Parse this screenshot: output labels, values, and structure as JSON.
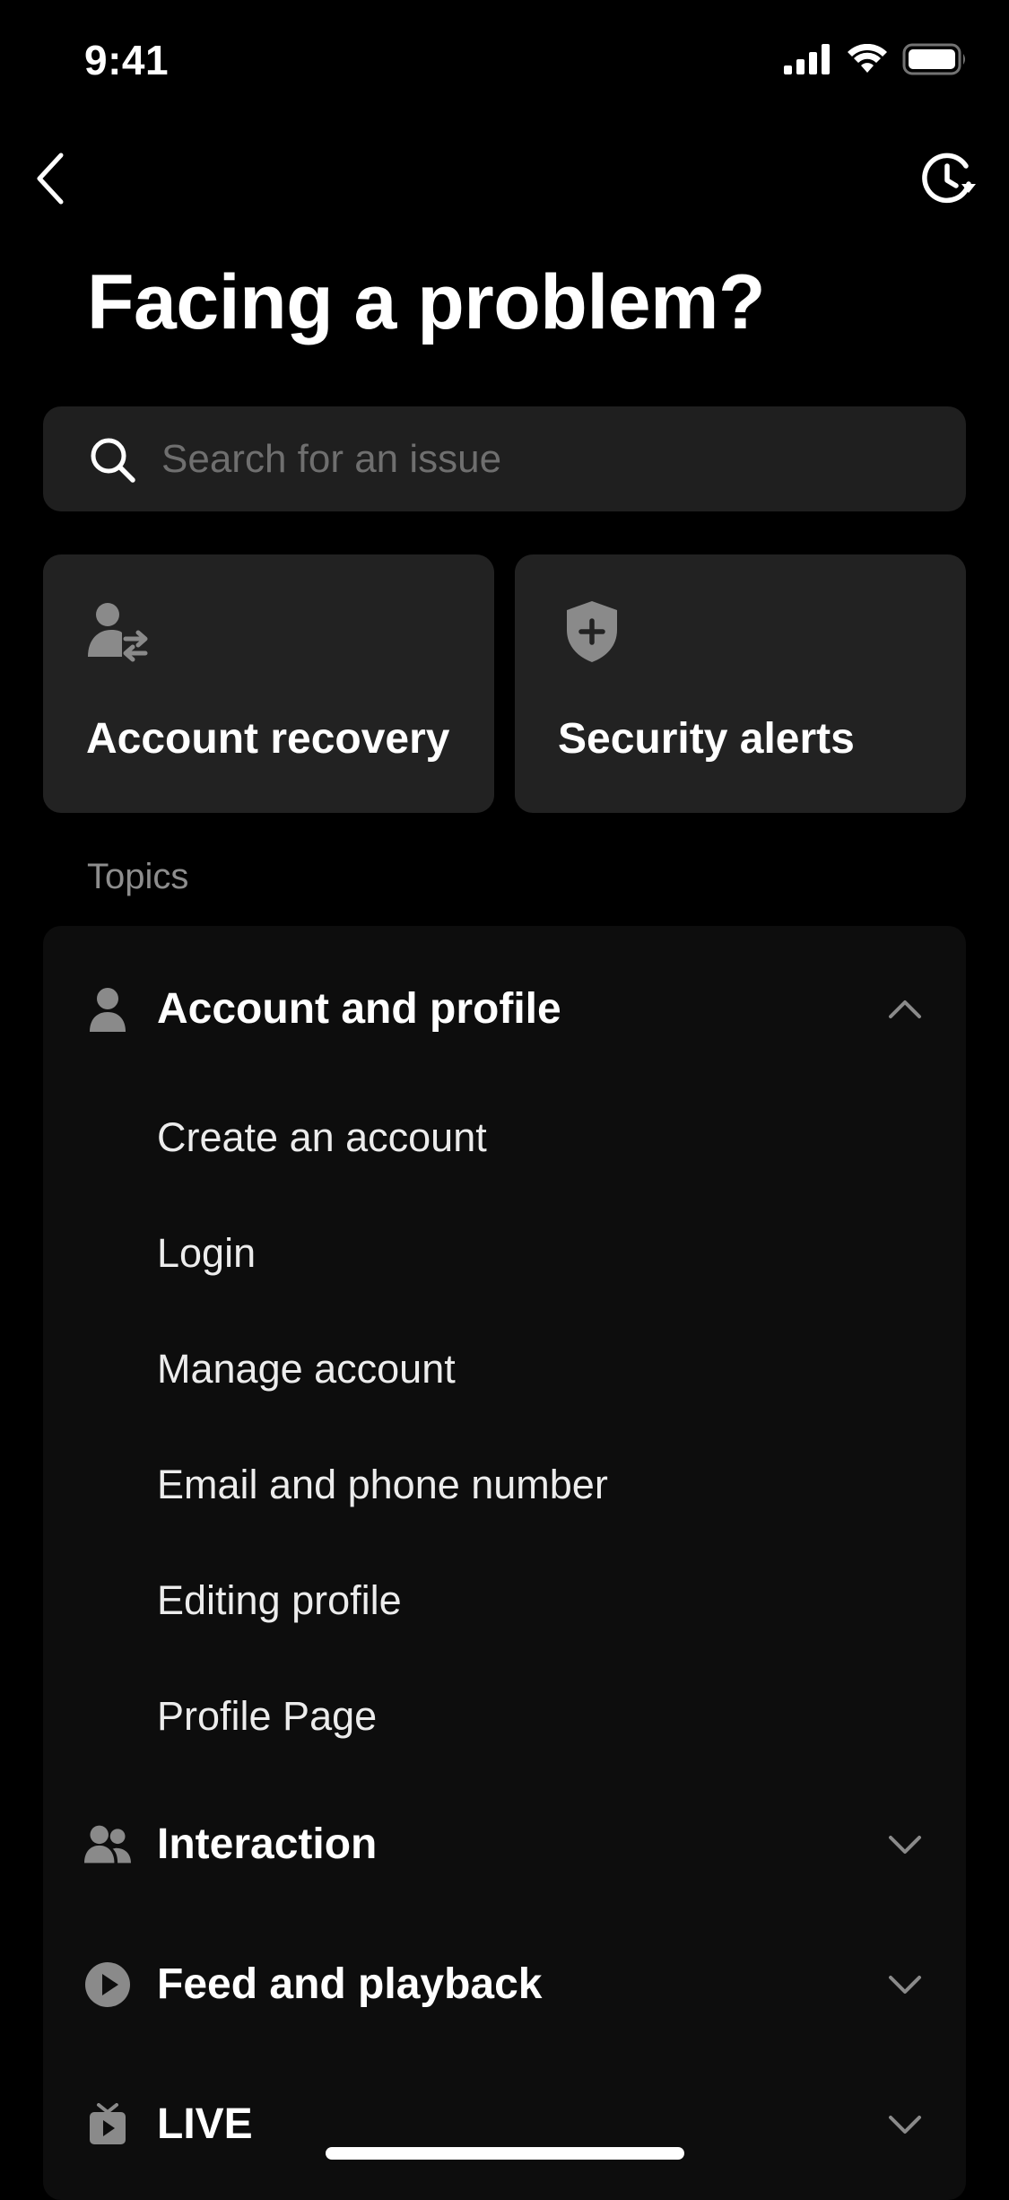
{
  "status_bar": {
    "time": "9:41"
  },
  "nav": {
    "back_icon": "chevron-left-icon",
    "history_icon": "history-clock-icon"
  },
  "page": {
    "title": "Facing a problem?"
  },
  "search": {
    "placeholder": "Search for an issue",
    "value": ""
  },
  "quick_actions": [
    {
      "label": "Account recovery",
      "icon": "user-switch-icon"
    },
    {
      "label": "Security alerts",
      "icon": "shield-plus-icon"
    }
  ],
  "topics": {
    "section_label": "Topics",
    "items": [
      {
        "label": "Account and profile",
        "icon": "person-icon",
        "expanded": true,
        "children": [
          "Create an account",
          "Login",
          "Manage account",
          "Email and phone number",
          "Editing profile",
          "Profile Page"
        ]
      },
      {
        "label": "Interaction",
        "icon": "people-icon",
        "expanded": false
      },
      {
        "label": "Feed and playback",
        "icon": "play-circle-icon",
        "expanded": false
      },
      {
        "label": "LIVE",
        "icon": "tv-icon",
        "expanded": false
      }
    ]
  },
  "colors": {
    "background": "#000000",
    "card": "#222222",
    "search_bg": "#1f1f1f",
    "panel": "#0d0d0d",
    "muted_text": "#8d8d8d",
    "icon_gray": "#8a8a8a"
  }
}
